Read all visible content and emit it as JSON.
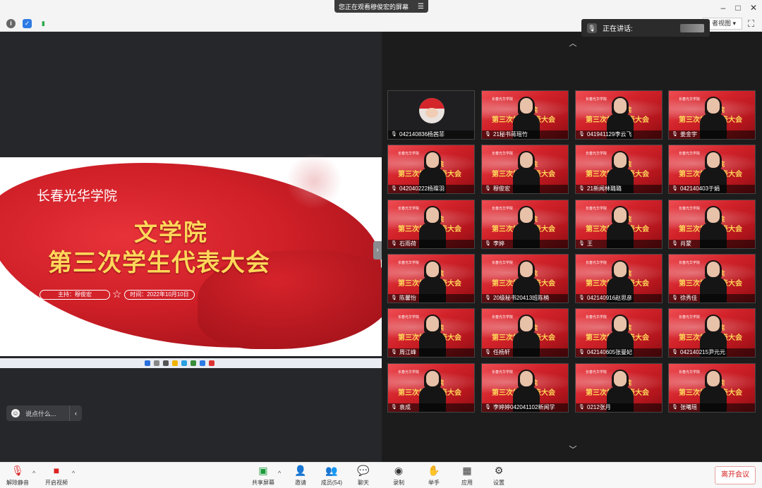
{
  "window": {
    "share_banner": "您正在观看穆俊宏的屏幕",
    "minimize": "–",
    "maximize": "□",
    "close": "✕"
  },
  "toolbar": {
    "view_label": "者视图",
    "speaking_label": "正在讲话:"
  },
  "slide": {
    "college": "长春光华学院",
    "title1": "文学院",
    "title2": "第三次学生代表大会",
    "host": "主持：穆俊宏",
    "time": "时间：2022年10月10日"
  },
  "chat": {
    "placeholder": "说点什么..."
  },
  "tile_text": {
    "school": "长春光华学院",
    "dept": "文学院",
    "meeting": "第三次学生代表大会"
  },
  "participants": [
    {
      "name": "042140836杨茜菲"
    },
    {
      "name": "21秘书蒋瑶竹"
    },
    {
      "name": "041941129李云飞"
    },
    {
      "name": "姜金宇"
    },
    {
      "name": "042040222杨璨羽"
    },
    {
      "name": "穆俊宏"
    },
    {
      "name": "21新闻林璐璐"
    },
    {
      "name": "042140403于娟"
    },
    {
      "name": "石雨荷"
    },
    {
      "name": "李婷"
    },
    {
      "name": "王"
    },
    {
      "name": "肖蒙"
    },
    {
      "name": "陈馨怡"
    },
    {
      "name": "20级秘书20413班陈楠"
    },
    {
      "name": "042140916赵思彦"
    },
    {
      "name": "徐秀佳"
    },
    {
      "name": "周江峰"
    },
    {
      "name": "任杨轩"
    },
    {
      "name": "042140605张曼妃"
    },
    {
      "name": "042140215尹元元"
    },
    {
      "name": "袁成"
    },
    {
      "name": "李婷婷042041102新闻学"
    },
    {
      "name": "0212张月"
    },
    {
      "name": "张曦瑶"
    }
  ],
  "bottom": {
    "mute": "解除静音",
    "video": "开启视频",
    "share": "共享屏幕",
    "invite": "邀请",
    "members": "成员(54)",
    "chat": "聊天",
    "record": "录制",
    "hand": "举手",
    "apps": "应用",
    "settings": "设置",
    "leave": "离开会议"
  }
}
